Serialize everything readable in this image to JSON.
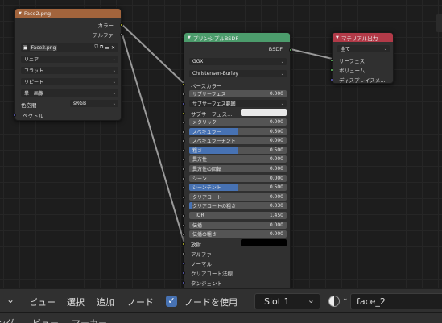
{
  "image_node": {
    "title": "Face2.png",
    "outputs": [
      "カラー",
      "アルファ"
    ],
    "image_name": "Face2.png",
    "interpolation": "リニア",
    "projection": "フラット",
    "extension": "リピート",
    "source": "単一画像",
    "color_space_label": "色空間",
    "color_space_value": "sRGB",
    "vector_label": "ベクトル",
    "header_color": "#a2643c"
  },
  "bsdf_node": {
    "title": "プリンシプルBSDF",
    "output": "BSDF",
    "distribution": "GGX",
    "subsurface_method": "Christensen-Burley",
    "base_color_label": "ベースカラー",
    "subsurface_label": "サブサーフェス",
    "subsurface_value": "0.000",
    "subsurface_radius_label": "サブサーフェス範囲",
    "subsurface_color_label": "サブサーフェス...",
    "sliders": [
      {
        "label": "メタリック",
        "value": "0.000",
        "fill": 0
      },
      {
        "label": "スペキュラー",
        "value": "0.500",
        "fill": 0.5
      },
      {
        "label": "スペキュラーチント",
        "value": "0.000",
        "fill": 0
      },
      {
        "label": "粗さ",
        "value": "0.500",
        "fill": 0.5
      },
      {
        "label": "異方性",
        "value": "0.000",
        "fill": 0
      },
      {
        "label": "異方性の回転",
        "value": "0.000",
        "fill": 0
      },
      {
        "label": "シーン",
        "value": "0.000",
        "fill": 0
      },
      {
        "label": "シーンチント",
        "value": "0.500",
        "fill": 0.5
      },
      {
        "label": "クリアコート",
        "value": "0.000",
        "fill": 0
      },
      {
        "label": "クリアコートの粗さ",
        "value": "0.030",
        "fill": 0.03
      },
      {
        "label": "IOR",
        "value": "1.450",
        "fill": 0
      },
      {
        "label": "伝播",
        "value": "0.000",
        "fill": 0
      },
      {
        "label": "伝播の粗さ",
        "value": "0.000",
        "fill": 0
      }
    ],
    "emission_label": "放射",
    "inputs_bottom": [
      "アルファ",
      "ノーマル",
      "クリアコート法線",
      "タンジェント"
    ],
    "header_color": "#4c9c6c"
  },
  "output_node": {
    "title": "マテリアル出力",
    "target": "全て",
    "inputs": [
      "サーフェス",
      "ボリューム",
      "ディスプレイスメ..."
    ],
    "header_color": "#b23a48"
  },
  "header": {
    "menus": [
      "ビュー",
      "選択",
      "追加",
      "ノード"
    ],
    "use_nodes_label": "ノードを使用",
    "slot": "Slot 1",
    "material_name": "face_2"
  },
  "bottom_bar": {
    "items": [
      "ング",
      "ビュー",
      "マーカー"
    ]
  }
}
